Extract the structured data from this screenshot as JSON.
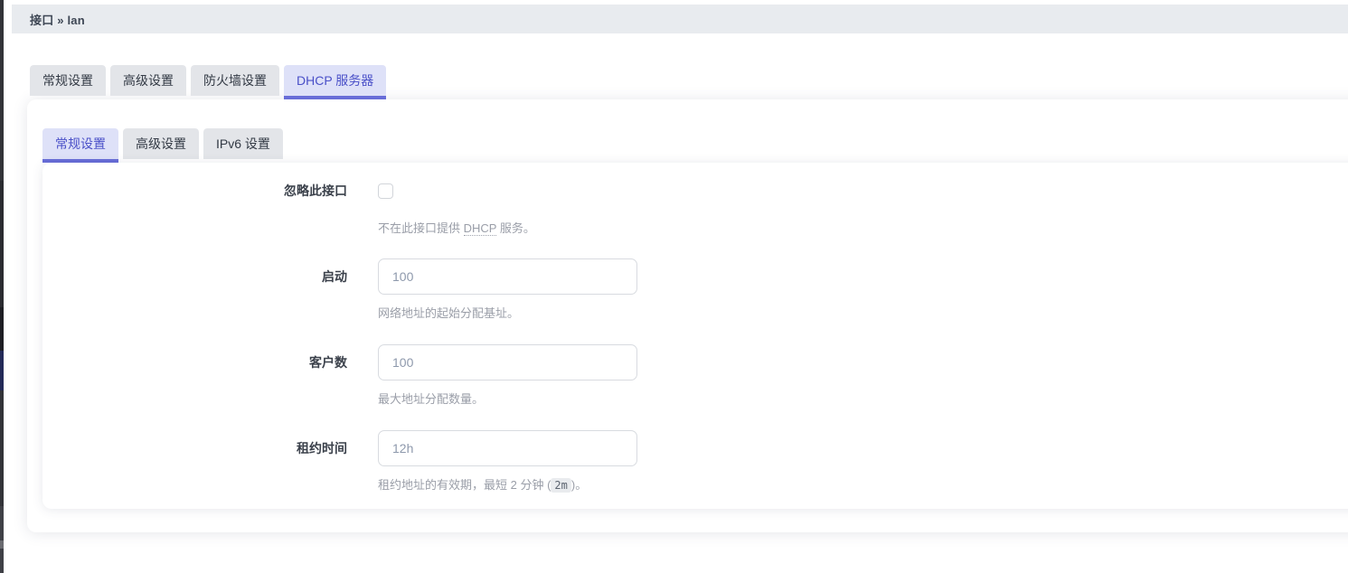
{
  "breadcrumb": {
    "text": "接口 » lan"
  },
  "main_tabs": [
    {
      "label": "常规设置",
      "active": false
    },
    {
      "label": "高级设置",
      "active": false
    },
    {
      "label": "防火墙设置",
      "active": false
    },
    {
      "label": "DHCP 服务器",
      "active": true
    }
  ],
  "sub_tabs": [
    {
      "label": "常规设置",
      "active": true
    },
    {
      "label": "高级设置",
      "active": false
    },
    {
      "label": "IPv6 设置",
      "active": false
    }
  ],
  "form": {
    "ignore_interface": {
      "label": "忽略此接口",
      "checked": false,
      "desc_prefix": "不在此接口提供 ",
      "desc_abbr": "DHCP",
      "desc_suffix": " 服务。"
    },
    "start": {
      "label": "启动",
      "value": "100",
      "description": "网络地址的起始分配基址。"
    },
    "limit": {
      "label": "客户数",
      "value": "100",
      "description": "最大地址分配数量。"
    },
    "lease_time": {
      "label": "租约时间",
      "value": "12h",
      "desc_prefix": "租约地址的有效期，最短 2 分钟 (",
      "desc_code": "2m",
      "desc_suffix": ")。"
    }
  },
  "colors": {
    "accent_purple": "#686dd8",
    "active_tab_bg": "#dee1f8",
    "active_tab_text": "#4a50c8",
    "inactive_tab_bg": "#e3e5e9",
    "breadcrumb_bg": "#e8ebef"
  }
}
